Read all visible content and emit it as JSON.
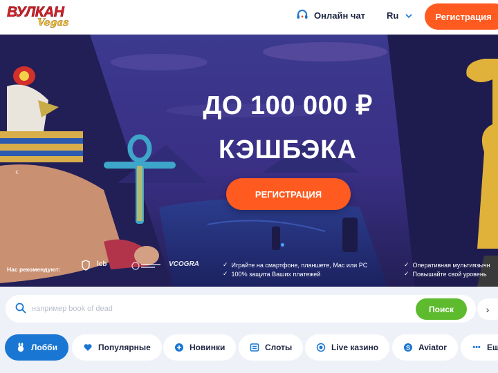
{
  "header": {
    "logo_text": "ВУЛКАН",
    "logo_sub": "Vegas",
    "chat_label": "Онлайн чат",
    "lang": "Ru",
    "register_label": "Регистрация"
  },
  "banner": {
    "line1": "ДО 100 000 ₽",
    "line2": "КЭШБЭКА",
    "cta": "РЕГИСТРАЦИЯ",
    "recommend_label": "Нас рекомендуют:",
    "partners": [
      "lcb",
      "VCOGRA"
    ],
    "features_left": [
      "Играйте на смартфоне, планшете, Mac или PC",
      "100% защита Ваших платежей"
    ],
    "features_right": [
      "Оперативная мультиязычн",
      "Повышайте свой уровень"
    ]
  },
  "search": {
    "placeholder": "например book of dead",
    "button": "Поиск"
  },
  "tabs": [
    {
      "label": "Лобби",
      "icon": "rabbit-icon",
      "active": true
    },
    {
      "label": "Популярные",
      "icon": "heart-icon",
      "active": false
    },
    {
      "label": "Новинки",
      "icon": "plus-icon",
      "active": false
    },
    {
      "label": "Слоты",
      "icon": "slots-icon",
      "active": false
    },
    {
      "label": "Live казино",
      "icon": "live-icon",
      "active": false
    },
    {
      "label": "Aviator",
      "icon": "aviator-icon",
      "active": false
    },
    {
      "label": "Ещ",
      "icon": "more-icon",
      "active": false
    }
  ],
  "colors": {
    "accent": "#ff5a1f",
    "active_tab": "#1976d2",
    "search_button": "#5dbb2d",
    "logo_red": "#d3202b",
    "logo_gold": "#f3c02e"
  }
}
